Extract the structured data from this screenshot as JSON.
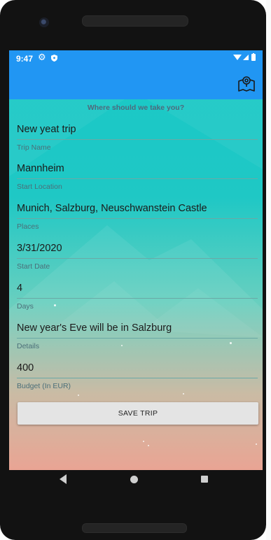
{
  "status_bar": {
    "time": "9:47"
  },
  "header": {
    "map_icon": "map-search-icon"
  },
  "form": {
    "subtitle": "Where should we take you?",
    "fields": [
      {
        "label": "Trip Name",
        "value": "New yeat trip"
      },
      {
        "label": "Start Location",
        "value": "Mannheim"
      },
      {
        "label": "Places",
        "value": "Munich, Salzburg, Neuschwanstein Castle"
      },
      {
        "label": "Start Date",
        "value": "3/31/2020"
      },
      {
        "label": "Days",
        "value": "4"
      },
      {
        "label": "Details",
        "value": "New year's Eve will be in Salzburg"
      },
      {
        "label": "Budget (In EUR)",
        "value": "400"
      }
    ],
    "save_label": "SAVE TRIP"
  },
  "colors": {
    "app_bar": "#2196f3",
    "gradient_top": "#19c9c7",
    "gradient_bottom": "#e89e8c"
  }
}
